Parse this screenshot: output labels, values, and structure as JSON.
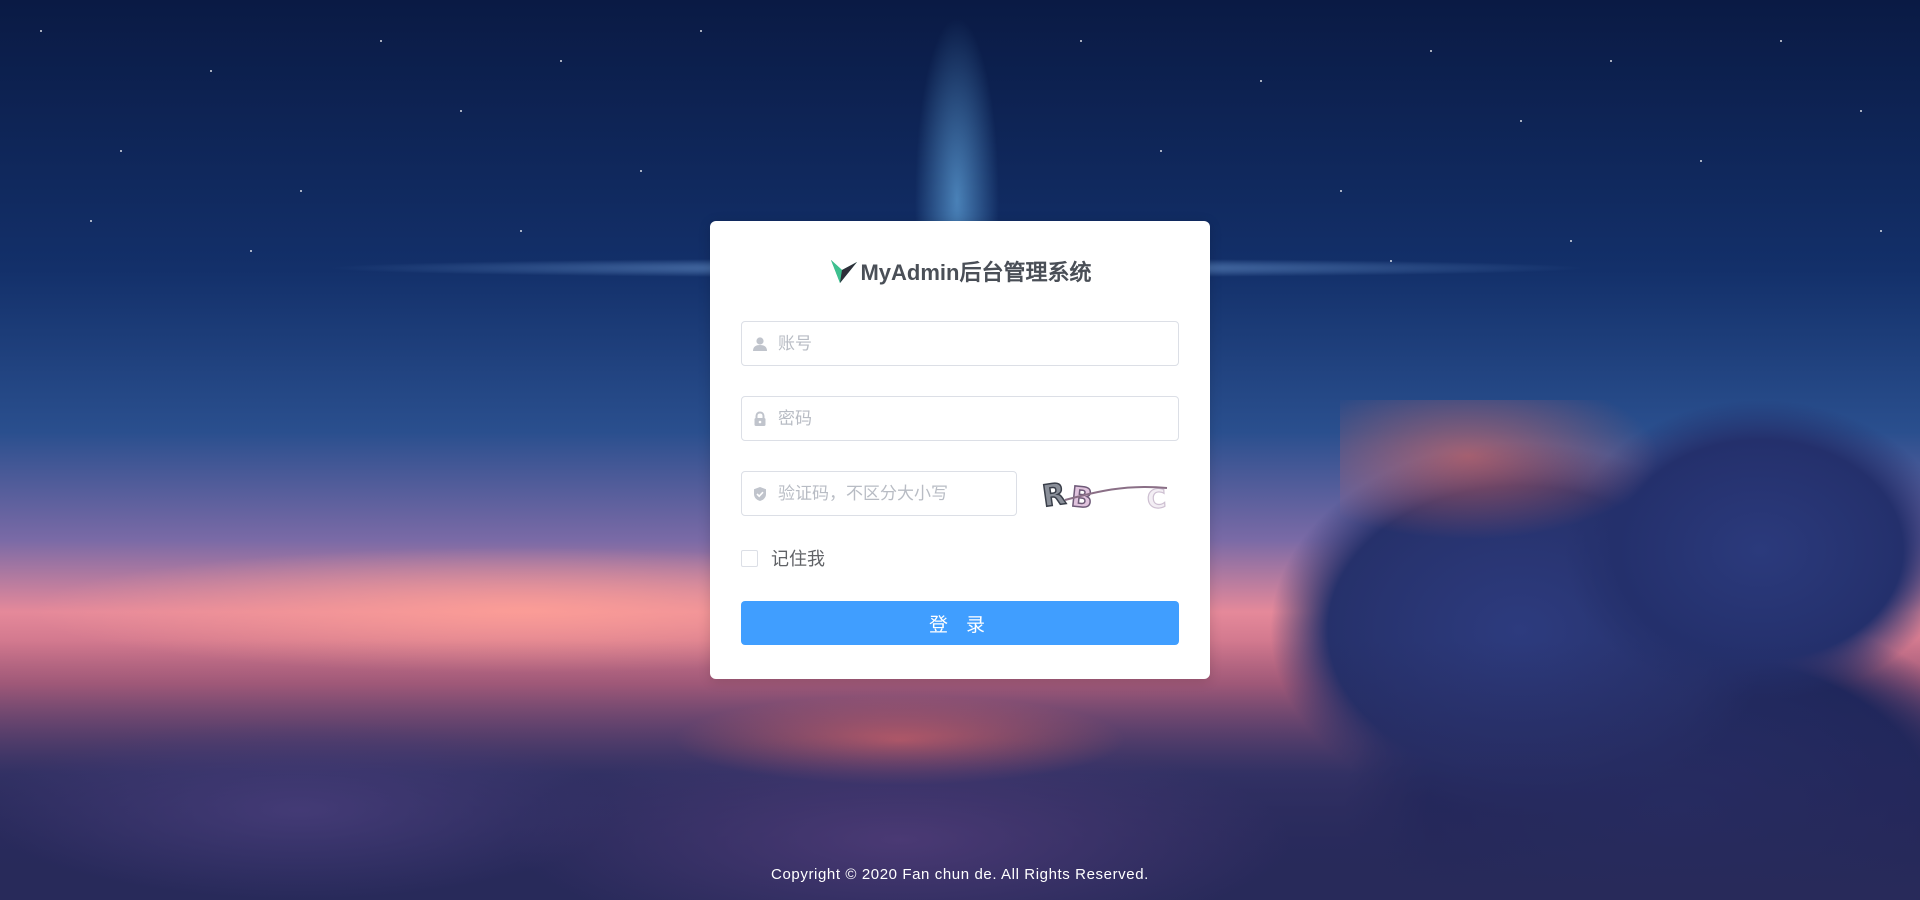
{
  "brand": {
    "title": "MyAdmin后台管理系统",
    "logo_icon": "myadmin-logo-icon",
    "title_color": "#4a4f57"
  },
  "login_form": {
    "account": {
      "placeholder": "账号",
      "value": "",
      "icon": "user-icon"
    },
    "password": {
      "placeholder": "密码",
      "value": "",
      "icon": "lock-icon"
    },
    "captcha": {
      "placeholder": "验证码，不区分大小写",
      "value": "",
      "icon": "shield-check-icon",
      "image_text": "RBC"
    },
    "remember_me": {
      "label": "记住我",
      "checked": false
    },
    "submit_label": "登 录",
    "submit_color": "#409eff"
  },
  "footer": {
    "copyright": "Copyright © 2020 Fan chun de. All Rights Reserved."
  }
}
